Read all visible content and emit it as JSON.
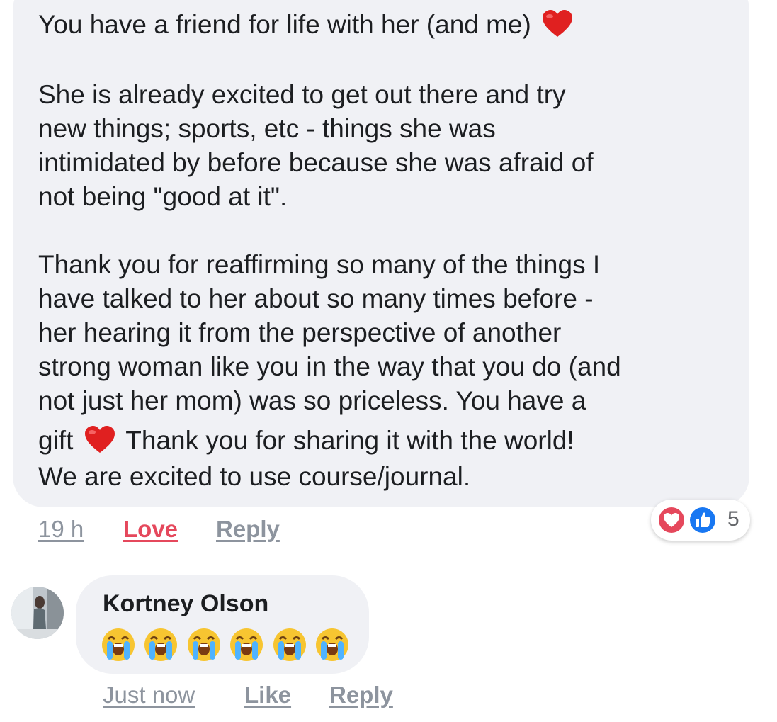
{
  "comment1": {
    "lines": [
      "You have a friend for life with her (and me)",
      "She is already excited to get out there and try",
      "new things; sports, etc - things she was",
      "intimidated by before because she was afraid of",
      "not being \"good at it\".",
      "Thank you for reaffirming so many of the things I",
      "have talked to her about so many times before -",
      "her hearing it from the perspective of another",
      "strong woman like you in the way that you do (and",
      "not just her mom) was so priceless. You have a",
      "gift",
      "Thank you for sharing it with the world!",
      "We are excited to use course/journal."
    ],
    "emoji_icon": "red-heart-icon",
    "time": "19 h",
    "reaction_label": "Love",
    "reply_label": "Reply",
    "reaction_icons": [
      "love-reaction-icon",
      "like-reaction-icon"
    ],
    "reaction_count": "5"
  },
  "comment2": {
    "author": "Kortney Olson",
    "emoji_icon": "loudly-crying-face-icon",
    "emoji_count": 6,
    "time": "Just now",
    "like_label": "Like",
    "reply_label": "Reply"
  },
  "colors": {
    "bubble": "#f0f1f5",
    "text": "#1c1e21",
    "meta": "#8d949e",
    "love": "#e5485c",
    "like_blue": "#1877f2",
    "heart_red": "#e02020"
  }
}
